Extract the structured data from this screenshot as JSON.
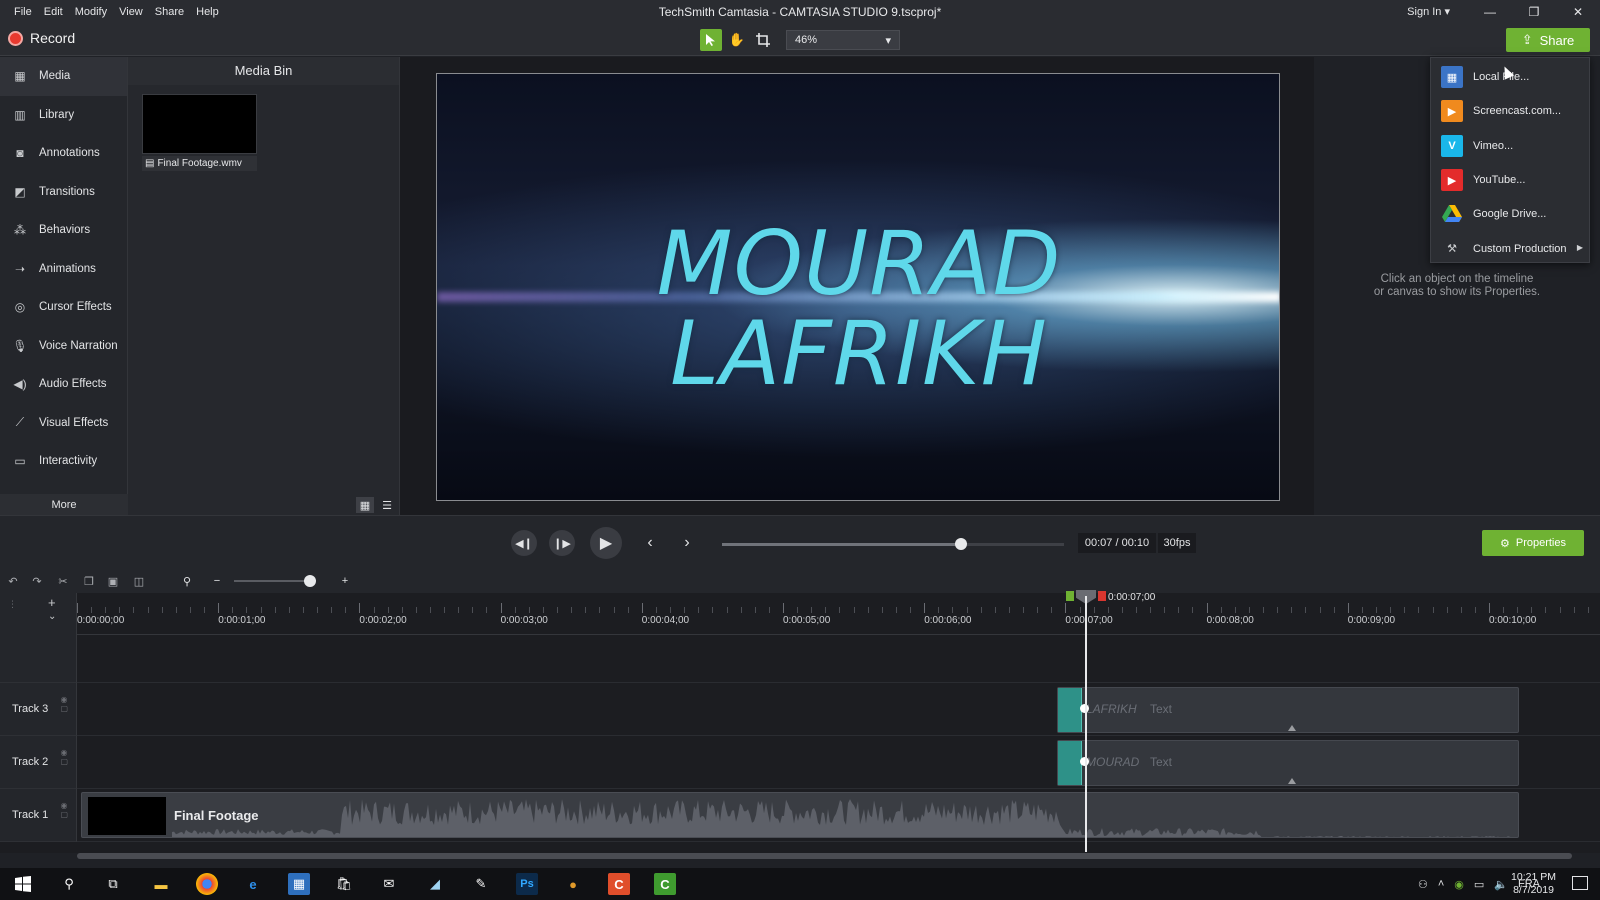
{
  "window": {
    "title": "TechSmith Camtasia - CAMTASIA STUDIO 9.tscproj*",
    "menu": [
      "File",
      "Edit",
      "Modify",
      "View",
      "Share",
      "Help"
    ],
    "sign_in": "Sign In ▾",
    "controls": [
      "—",
      "❐",
      "✕"
    ]
  },
  "toolbar": {
    "record_label": "Record",
    "zoom_value": "46%",
    "share_label": "Share"
  },
  "leftnav": {
    "items": [
      {
        "label": "Media",
        "icon": "media-icon"
      },
      {
        "label": "Library",
        "icon": "library-icon"
      },
      {
        "label": "Annotations",
        "icon": "annotations-icon"
      },
      {
        "label": "Transitions",
        "icon": "transitions-icon"
      },
      {
        "label": "Behaviors",
        "icon": "behaviors-icon"
      },
      {
        "label": "Animations",
        "icon": "animations-icon"
      },
      {
        "label": "Cursor Effects",
        "icon": "cursor-effects-icon"
      },
      {
        "label": "Voice Narration",
        "icon": "microphone-icon"
      },
      {
        "label": "Audio Effects",
        "icon": "speaker-icon"
      },
      {
        "label": "Visual Effects",
        "icon": "wand-icon"
      },
      {
        "label": "Interactivity",
        "icon": "interactivity-icon"
      }
    ],
    "more_label": "More"
  },
  "mediabin": {
    "title": "Media Bin",
    "file_name": "Final Footage.wmv"
  },
  "canvas": {
    "line1": "MOURAD",
    "line2": "LAFRIKH"
  },
  "properties": {
    "hint_line1": "Click an object on the timeline",
    "hint_line2": "or canvas to show its Properties.",
    "button_label": "Properties"
  },
  "share_menu": {
    "items": [
      {
        "label": "Local File...",
        "icon": "local-file-icon",
        "color": "#3b74c6"
      },
      {
        "label": "Screencast.com...",
        "icon": "screencast-icon",
        "color": "#f08a1e"
      },
      {
        "label": "Vimeo...",
        "icon": "vimeo-icon",
        "color": "#1ab7ea"
      },
      {
        "label": "YouTube...",
        "icon": "youtube-icon",
        "color": "#e32b2b"
      },
      {
        "label": "Google Drive...",
        "icon": "google-drive-icon",
        "color": "#34a853"
      },
      {
        "label": "Custom Production",
        "icon": "tools-icon",
        "color": "#c8cacd"
      }
    ]
  },
  "playback": {
    "time": "00:07 / 00:10",
    "fps": "30fps",
    "progress": 0.7
  },
  "timeline": {
    "playhead_time": "0:00:07;00",
    "ruler_labels": [
      "0:00:00;00",
      "0:00:01;00",
      "0:00:02;00",
      "0:00:03;00",
      "0:00:04;00",
      "0:00:05;00",
      "0:00:06;00",
      "0:00:07;00",
      "0:00:08;00",
      "0:00:09;00",
      "0:00:10;00"
    ],
    "tracks": [
      {
        "name": "Track 3",
        "clip_text": "LAFRIKH",
        "clip_type": "Text"
      },
      {
        "name": "Track 2",
        "clip_text": "MOURAD",
        "clip_type": "Text"
      },
      {
        "name": "Track 1",
        "clip_text": "Final Footage",
        "clip_type": ""
      }
    ]
  },
  "taskbar": {
    "language": "FRA",
    "time": "10:21 PM",
    "date": "8/7/2019"
  },
  "colors": {
    "accent_green": "#6fb233",
    "record_red": "#e8392f",
    "clip_teal": "#2e9188",
    "canvas_text": "#5fd8ea"
  }
}
